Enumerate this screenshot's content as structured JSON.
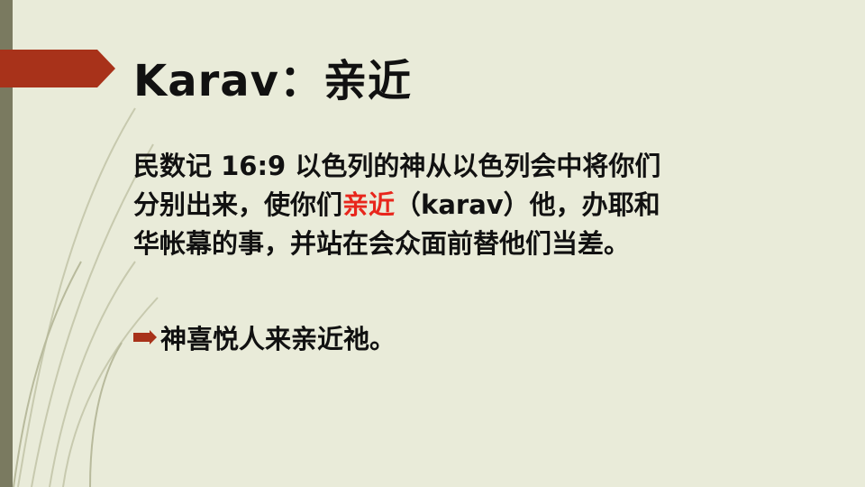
{
  "slide": {
    "title": "Karav：亲近",
    "verse": {
      "line1": "民数记 16:9  以色列的神从以色列会中将你们",
      "line2_before": "分别出来，使你们",
      "line2_highlight": "亲近",
      "line2_after": "（karav）他，办耶和",
      "line3": "华帐幕的事，并站在会众面前替他们当差。"
    },
    "bullet": {
      "icon": "arrow-bullet-icon",
      "text": "神喜悦人来亲近祂。"
    }
  },
  "colors": {
    "background": "#e9ebd9",
    "title_arrow": "#a8321a",
    "highlight": "#e8261c",
    "left_bar": "#7a7a60"
  }
}
